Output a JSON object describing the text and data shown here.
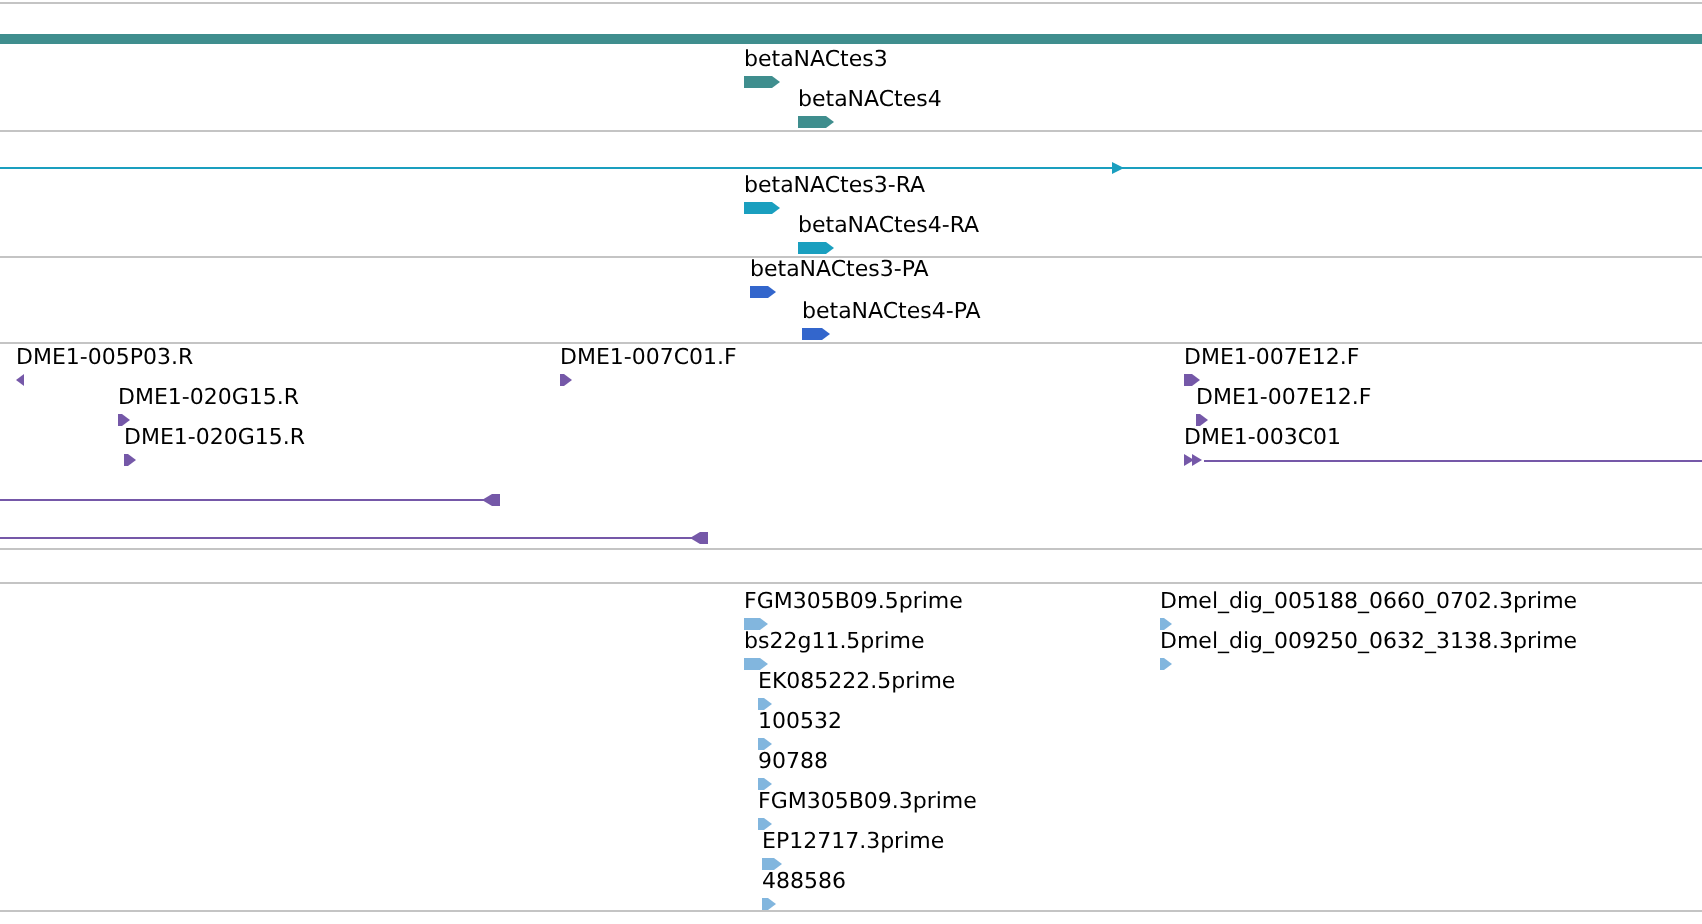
{
  "tracks": [
    {
      "color": "#3f8e8e",
      "features": [
        {
          "kind": "bar"
        },
        {
          "kind": "labeled",
          "label": "betaNACtes3",
          "reverse": false
        },
        {
          "kind": "labeled",
          "label": "betaNACtes4",
          "reverse": false
        }
      ]
    },
    {
      "color": "#1a9fbf",
      "features": [
        {
          "kind": "line",
          "reverse": false
        },
        {
          "kind": "labeled",
          "label": "betaNACtes3-RA",
          "reverse": false
        },
        {
          "kind": "labeled",
          "label": "betaNACtes4-RA",
          "reverse": false
        }
      ]
    },
    {
      "color": "#3366cc",
      "features": [
        {
          "kind": "labeled",
          "label": "betaNACtes3-PA",
          "reverse": false
        },
        {
          "kind": "labeled",
          "label": "betaNACtes4-PA",
          "reverse": false
        }
      ]
    },
    {
      "color": "#7558a8",
      "features": [
        {
          "kind": "labeled",
          "label": "DME1-005P03.R",
          "reverse": true
        },
        {
          "kind": "labeled",
          "label": "DME1-020G15.R",
          "reverse": false
        },
        {
          "kind": "labeled",
          "label": "DME1-020G15.R",
          "reverse": false
        },
        {
          "kind": "labeled",
          "label": "DME1-007C01.F",
          "reverse": false
        },
        {
          "kind": "labeled",
          "label": "DME1-007E12.F",
          "reverse": false
        },
        {
          "kind": "labeled",
          "label": "DME1-007E12.F",
          "reverse": false
        },
        {
          "kind": "labeled-line",
          "label": "DME1-003C01",
          "reverse": false
        },
        {
          "kind": "line",
          "reverse": true
        },
        {
          "kind": "line",
          "reverse": true
        }
      ]
    },
    {
      "color": "#82b6de",
      "features": [
        {
          "kind": "labeled",
          "label": "FGM305B09.5prime",
          "reverse": false
        },
        {
          "kind": "labeled",
          "label": "bs22g11.5prime",
          "reverse": false
        },
        {
          "kind": "labeled",
          "label": "EK085222.5prime",
          "reverse": false
        },
        {
          "kind": "labeled",
          "label": "100532",
          "reverse": false
        },
        {
          "kind": "labeled",
          "label": "90788",
          "reverse": false
        },
        {
          "kind": "labeled",
          "label": "FGM305B09.3prime",
          "reverse": false
        },
        {
          "kind": "labeled",
          "label": "EP12717.3prime",
          "reverse": false
        },
        {
          "kind": "labeled",
          "label": "488586",
          "reverse": false
        },
        {
          "kind": "labeled",
          "label": "Dmel_dig_005188_0660_0702.3prime",
          "reverse": false
        },
        {
          "kind": "labeled",
          "label": "Dmel_dig_009250_0632_3138.3prime",
          "reverse": false
        }
      ]
    }
  ]
}
